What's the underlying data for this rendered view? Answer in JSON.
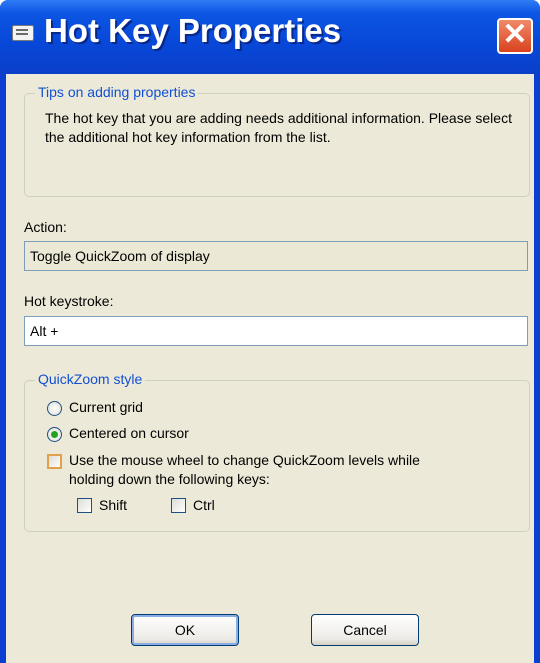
{
  "window": {
    "title": "Hot Key Properties",
    "close_symbol": "✕"
  },
  "tips": {
    "legend": "Tips on adding properties",
    "text": "The hot key that you are adding needs additional information. Please select the additional hot key information from the list."
  },
  "action": {
    "label": "Action:",
    "value": "Toggle QuickZoom of display"
  },
  "hotkey": {
    "label": "Hot keystroke:",
    "value": "Alt +"
  },
  "quickzoom": {
    "legend": "QuickZoom style",
    "options": [
      {
        "label": "Current grid",
        "selected": false
      },
      {
        "label": "Centered on cursor",
        "selected": true
      }
    ],
    "wheel_label_line1": "Use the mouse wheel to change QuickZoom levels while",
    "wheel_label_line2": "holding down the following keys:",
    "wheel_checked": false,
    "shift_label": "Shift",
    "ctrl_label": "Ctrl"
  },
  "buttons": {
    "ok": "OK",
    "cancel": "Cancel"
  }
}
